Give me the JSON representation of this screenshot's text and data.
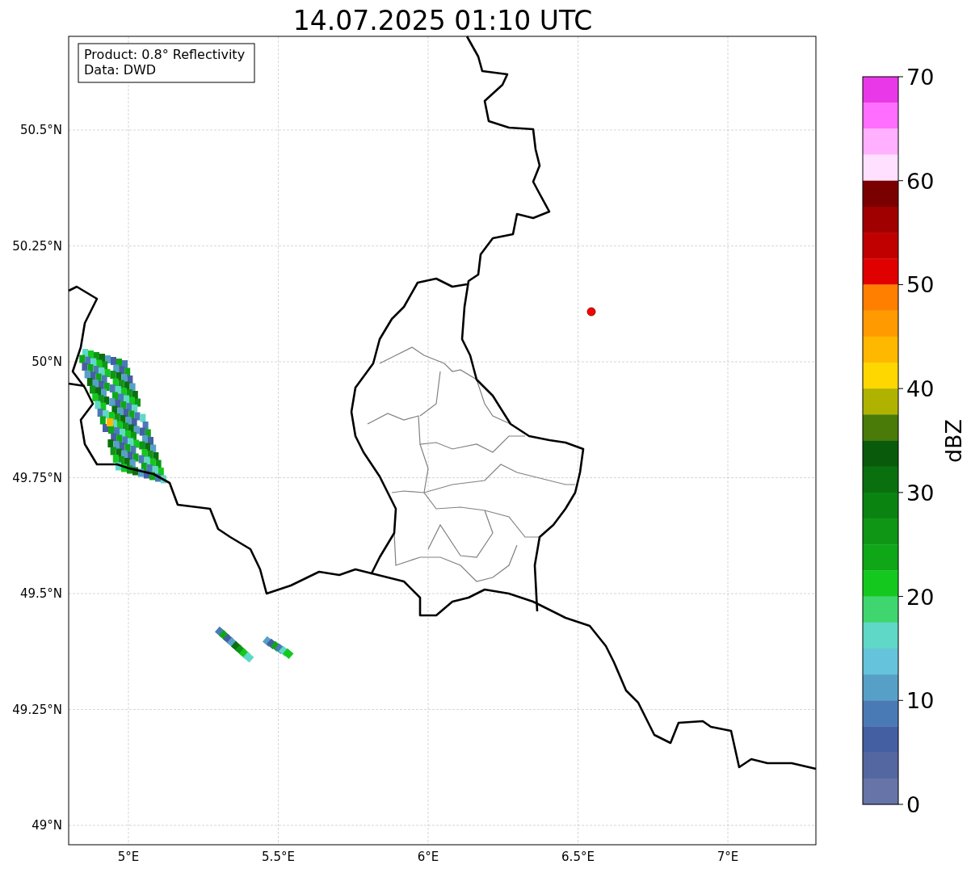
{
  "title": "14.07.2025 01:10 UTC",
  "info_box": {
    "lines": [
      "Product: 0.8° Reflectivity",
      "Data: DWD"
    ]
  },
  "map": {
    "lat_ticks": [
      "50.5°N",
      "50.25°N",
      "50°N",
      "49.75°N",
      "49.5°N",
      "49.25°N",
      "49°N"
    ],
    "lon_ticks": [
      "5°E",
      "5.5°E",
      "6°E",
      "6.5°E",
      "7°E"
    ]
  },
  "colorbar": {
    "label": "dBZ",
    "ticks": [
      "70",
      "60",
      "50",
      "40",
      "30",
      "20",
      "10",
      "0"
    ],
    "bins": [
      {
        "color": "#e838e8"
      },
      {
        "color": "#ff6eff"
      },
      {
        "color": "#ffb0ff"
      },
      {
        "color": "#ffe0ff"
      },
      {
        "color": "#7a0000"
      },
      {
        "color": "#a00000"
      },
      {
        "color": "#c00000"
      },
      {
        "color": "#e00000"
      },
      {
        "color": "#ff7f00"
      },
      {
        "color": "#ff9b00"
      },
      {
        "color": "#ffb800"
      },
      {
        "color": "#ffd700"
      },
      {
        "color": "#b0b200"
      },
      {
        "color": "#4a7a08"
      },
      {
        "color": "#095a0b"
      },
      {
        "color": "#0a700f"
      },
      {
        "color": "#0b8311"
      },
      {
        "color": "#0e9614"
      },
      {
        "color": "#0fa718"
      },
      {
        "color": "#14c81e"
      },
      {
        "color": "#3fd670"
      },
      {
        "color": "#60d8c8"
      },
      {
        "color": "#66c3dc"
      },
      {
        "color": "#56a0c8"
      },
      {
        "color": "#4a7ab5"
      },
      {
        "color": "#455fa3"
      },
      {
        "color": "#5567a0"
      },
      {
        "color": "#6674a8"
      }
    ]
  }
}
